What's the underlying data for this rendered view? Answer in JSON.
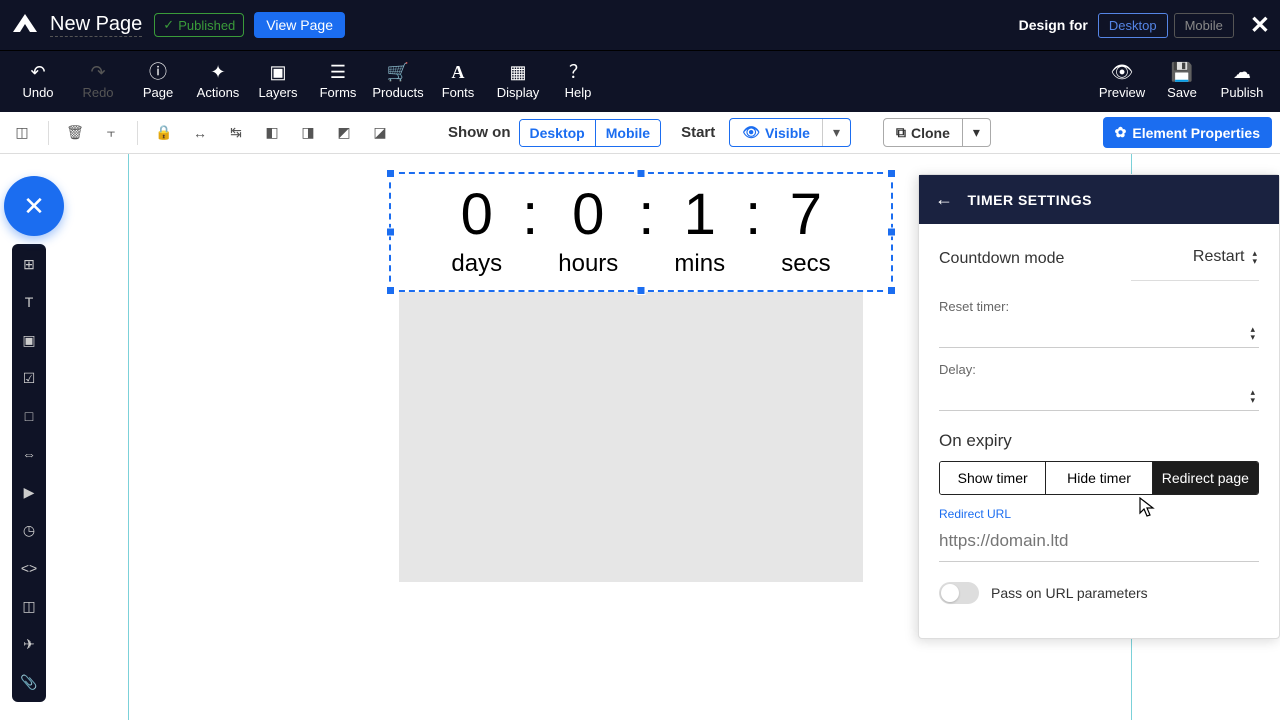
{
  "topbar": {
    "page_title": "New Page",
    "published_label": "Published",
    "view_page": "View Page",
    "design_for": "Design for",
    "design_desktop": "Desktop",
    "design_mobile": "Mobile"
  },
  "ribbon": {
    "undo": "Undo",
    "redo": "Redo",
    "page": "Page",
    "actions": "Actions",
    "layers": "Layers",
    "forms": "Forms",
    "products": "Products",
    "fonts": "Fonts",
    "display": "Display",
    "help": "Help",
    "preview": "Preview",
    "save": "Save",
    "publish": "Publish"
  },
  "toolbar": {
    "show_on": "Show on",
    "desktop": "Desktop",
    "mobile": "Mobile",
    "start": "Start",
    "visible": "Visible",
    "clone": "Clone",
    "element_properties": "Element Properties"
  },
  "timer": {
    "days_val": "0",
    "hours_val": "0",
    "mins_val": "1",
    "secs_val": "7",
    "days_label": "days",
    "hours_label": "hours",
    "mins_label": "mins",
    "secs_label": "secs"
  },
  "panel": {
    "title": "TIMER SETTINGS",
    "countdown_mode_label": "Countdown mode",
    "countdown_mode_value": "Restart",
    "reset_timer_label": "Reset timer:",
    "delay_label": "Delay:",
    "on_expiry": "On expiry",
    "show_timer": "Show timer",
    "hide_timer": "Hide timer",
    "redirect_page": "Redirect page",
    "redirect_url_label": "Redirect URL",
    "redirect_url_placeholder": "https://domain.ltd",
    "pass_params": "Pass on URL parameters"
  }
}
